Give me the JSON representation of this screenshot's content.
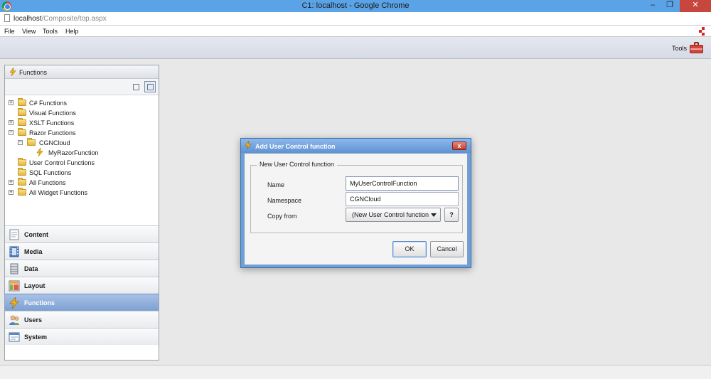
{
  "window": {
    "title": "C1: localhost - Google Chrome",
    "min": "–",
    "max": "❐",
    "close": "✕"
  },
  "address": {
    "host": "localhost",
    "path": "/Composite/top.aspx"
  },
  "menu": {
    "file": "File",
    "view": "View",
    "tools": "Tools",
    "help": "Help"
  },
  "toolbar": {
    "tools_label": "Tools"
  },
  "left_panel": {
    "header": "Functions",
    "tree": [
      {
        "label": "C# Functions",
        "expander": "+"
      },
      {
        "label": "Visual Functions"
      },
      {
        "label": "XSLT Functions",
        "expander": "+"
      },
      {
        "label": "Razor Functions",
        "expander": "−"
      },
      {
        "label": "CGNCloud",
        "expander": "−"
      },
      {
        "label": "MyRazorFunction"
      },
      {
        "label": "User Control Functions"
      },
      {
        "label": "SQL Functions"
      },
      {
        "label": "All Functions",
        "expander": "+"
      },
      {
        "label": "All Widget Functions",
        "expander": "+"
      }
    ],
    "nav": [
      {
        "label": "Content"
      },
      {
        "label": "Media"
      },
      {
        "label": "Data"
      },
      {
        "label": "Layout"
      },
      {
        "label": "Functions",
        "active": true
      },
      {
        "label": "Users"
      },
      {
        "label": "System"
      }
    ]
  },
  "dialog": {
    "title": "Add User Control function",
    "close": "x",
    "group_title": "New User Control function",
    "name_label": "Name",
    "name_value": "MyUserControlFunction",
    "namespace_label": "Namespace",
    "namespace_value": "CGNCloud",
    "copy_from_label": "Copy from",
    "copy_from_value": "(New User Control function",
    "help": "?",
    "ok": "OK",
    "cancel": "Cancel"
  },
  "colors": {
    "accent": "#5aa3e6",
    "active_nav": "#7c9fd3",
    "close_red": "#c7463e"
  }
}
